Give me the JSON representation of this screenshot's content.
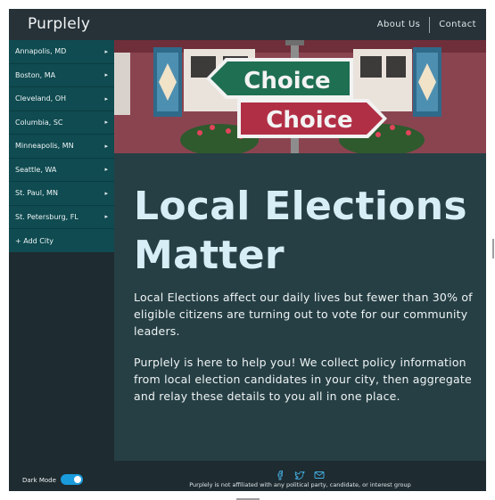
{
  "app": {
    "brand": "Purplely"
  },
  "nav": {
    "about": "About Us",
    "contact": "Contact"
  },
  "sidebar": {
    "cities": [
      {
        "label": "Annapolis, MD"
      },
      {
        "label": "Boston, MA"
      },
      {
        "label": "Cleveland, OH"
      },
      {
        "label": "Columbia, SC"
      },
      {
        "label": "Minneapolis, MN"
      },
      {
        "label": "Seattle, WA"
      },
      {
        "label": "St. Paul, MN"
      },
      {
        "label": "St. Petersburg, FL"
      }
    ],
    "add_city": "+ Add City"
  },
  "hero": {
    "sign_top": "Choice",
    "sign_bottom": "Choice"
  },
  "main": {
    "headline": "Local Elections Matter",
    "paragraph1": "Local Elections affect our daily lives but fewer than 30% of eligible citizens are turning out to vote for our community leaders.",
    "paragraph2": "Purplely is here to help you! We collect policy information from local election candidates in your city, then aggregate and relay these details to you all in one place."
  },
  "footer": {
    "icons": [
      "facebook-icon",
      "twitter-icon",
      "mail-icon"
    ],
    "disclaimer": "Purplely is not affiliated with any political party, candidate, or interest group",
    "dark_mode_label": "Dark Mode",
    "dark_mode_on": true
  },
  "colors": {
    "topbar": "#263238",
    "sidebar_item": "#0f4b51",
    "content_bg": "#263f44",
    "headline": "#d8eef6",
    "toggle": "#1a9bdc"
  }
}
